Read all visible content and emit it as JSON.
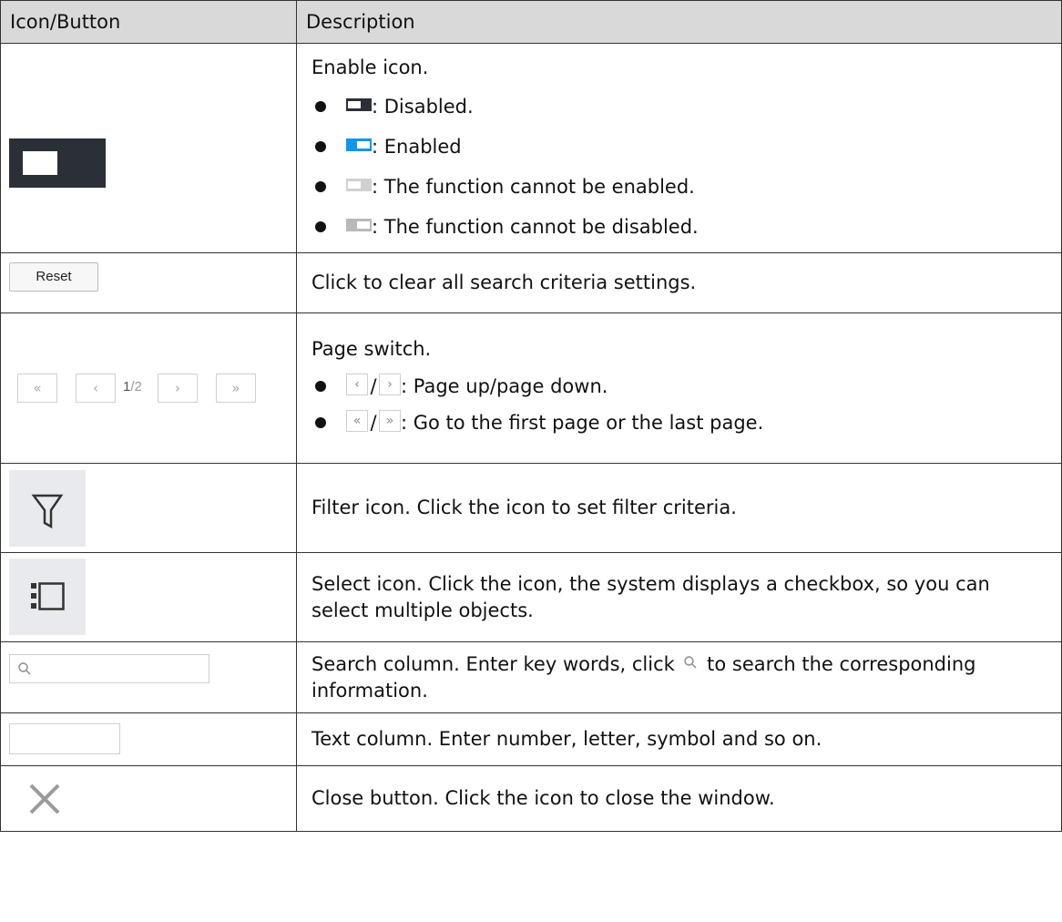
{
  "header": {
    "col1": "Icon/Button",
    "col2": "Description"
  },
  "toggle_row": {
    "intro": "Enable icon.",
    "items": [
      {
        "state_icon": "toggle-disabled-icon",
        "color": "#2b2f36",
        "text": ": Disabled."
      },
      {
        "state_icon": "toggle-enabled-icon",
        "color": "#1196ee",
        "text": ": Enabled"
      },
      {
        "state_icon": "toggle-cannot-enable-icon",
        "color": "#d0d0d0",
        "text": ": The function cannot be enabled."
      },
      {
        "state_icon": "toggle-cannot-disable-icon",
        "color": "#b9b9b9",
        "text": ": The function cannot be disabled."
      }
    ]
  },
  "reset_row": {
    "button_label": "Reset",
    "desc": "Click to clear all search criteria settings."
  },
  "page_row": {
    "current": "1",
    "total": "/2",
    "intro": "Page switch.",
    "items": [
      {
        "text": ": Page up/page down."
      },
      {
        "text": ": Go to the first page or the last page."
      }
    ]
  },
  "filter_row": {
    "icon": "filter-icon",
    "desc": "Filter icon. Click the icon to set filter criteria."
  },
  "select_row": {
    "icon": "select-list-icon",
    "desc": "Select icon. Click the icon, the system displays a checkbox, so you can select multiple objects."
  },
  "search_row": {
    "icon": "search-icon",
    "desc_before": "Search column. Enter key words, click",
    "desc_after": "to search the corresponding information."
  },
  "text_row": {
    "desc": "Text column. Enter number, letter, symbol and so on."
  },
  "close_row": {
    "icon": "close-icon",
    "desc": "Close button. Click the icon to close the window."
  }
}
